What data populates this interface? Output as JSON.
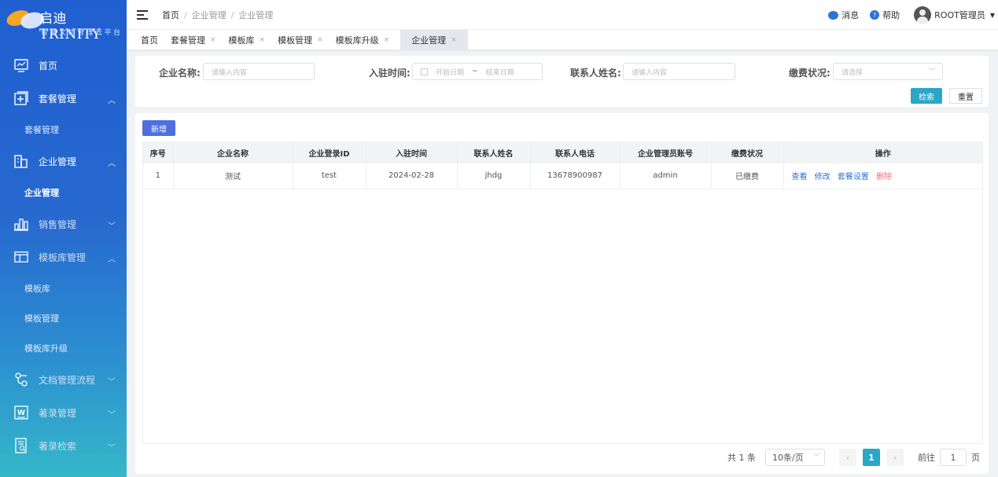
{
  "app": {
    "title": "启迪 TRINITY",
    "subtitle": "智慧文档管理云平台"
  },
  "sidebar": {
    "items": [
      {
        "label": "首页",
        "icon": "monitor-icon"
      },
      {
        "label": "套餐管理",
        "icon": "plus-square-icon",
        "arrow": "^"
      },
      {
        "label": "套餐管理",
        "sub": true
      },
      {
        "label": "企业管理",
        "icon": "building-icon",
        "arrow": "^"
      },
      {
        "label": "企业管理",
        "sub": true,
        "active": true
      },
      {
        "label": "销售管理",
        "icon": "bar-chart-icon",
        "arrow": "v"
      },
      {
        "label": "模板库管理",
        "icon": "template-icon",
        "arrow": "^"
      },
      {
        "label": "模板库",
        "sub": true
      },
      {
        "label": "模板管理",
        "sub": true
      },
      {
        "label": "模板库升级",
        "sub": true
      },
      {
        "label": "文档管理流程",
        "icon": "flow-icon",
        "arrow": "v"
      },
      {
        "label": "著录管理",
        "icon": "word-doc-icon",
        "arrow": "v"
      },
      {
        "label": "著录检索",
        "icon": "doc-search-icon",
        "arrow": "v"
      }
    ]
  },
  "header": {
    "breadcrumb": [
      "首页",
      "企业管理",
      "企业管理"
    ],
    "messages": "消息",
    "help": "帮助",
    "user": "ROOT管理员"
  },
  "tabs": [
    {
      "label": "首页",
      "closable": false
    },
    {
      "label": "套餐管理",
      "closable": true
    },
    {
      "label": "模板库",
      "closable": true
    },
    {
      "label": "模板管理",
      "closable": true
    },
    {
      "label": "模板库升级",
      "closable": true
    },
    {
      "label": "企业管理",
      "closable": true,
      "active": true
    }
  ],
  "search": {
    "company_label": "企业名称:",
    "company_placeholder": "请输入内容",
    "date_label": "入驻时间:",
    "date_start": "开始日期",
    "date_sep": "~",
    "date_end": "结束日期",
    "contact_label": "联系人姓名:",
    "contact_placeholder": "请输入内容",
    "pay_label": "缴费状况:",
    "pay_placeholder": "请选择",
    "search_btn": "检索",
    "reset_btn": "重置"
  },
  "toolbar": {
    "add_btn": "新增"
  },
  "table": {
    "columns": [
      "序号",
      "企业名称",
      "企业登录ID",
      "入驻时间",
      "联系人姓名",
      "联系人电话",
      "企业管理员账号",
      "缴费状况",
      "操作"
    ],
    "rows": [
      {
        "index": "1",
        "name": "测试",
        "login_id": "test",
        "date": "2024-02-28",
        "contact": "jhdg",
        "phone": "13678900987",
        "admin": "admin",
        "pay": "已缴费"
      }
    ],
    "ops": [
      "查看",
      "修改",
      "套餐设置",
      "删除"
    ]
  },
  "pagination": {
    "total": "共 1 条",
    "page_size": "10条/页",
    "current": "1",
    "goto_label": "前往",
    "goto_value": "1",
    "page_unit": "页"
  },
  "colors": {
    "primary": "#2aa6c8",
    "add": "#4e6fe0",
    "link": "#2e72d6",
    "danger": "#f56c6c"
  }
}
